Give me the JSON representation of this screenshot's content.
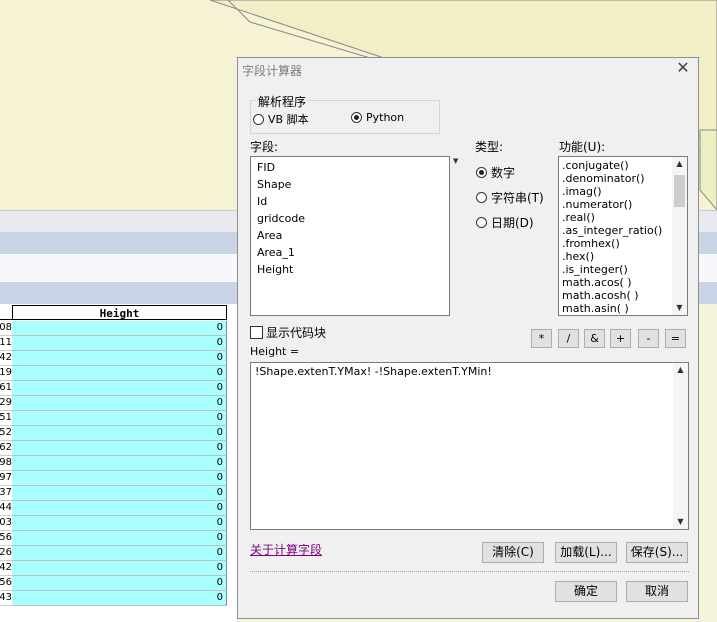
{
  "dialog": {
    "title": "字段计算器",
    "parser": {
      "label": "解析程序",
      "options": [
        {
          "label": "VB 脚本",
          "selected": false
        },
        {
          "label": "Python",
          "selected": true
        }
      ]
    },
    "fields_label": "字段:",
    "fields": [
      "FID",
      "Shape",
      "Id",
      "gridcode",
      "Area",
      "Area_1",
      "Height"
    ],
    "type_label": "类型:",
    "types": [
      {
        "label": "数字",
        "selected": true
      },
      {
        "label": "字符串(T)",
        "selected": false
      },
      {
        "label": "日期(D)",
        "selected": false
      }
    ],
    "functions_label": "功能(U):",
    "functions": [
      ".conjugate()",
      ".denominator()",
      ".imag()",
      ".numerator()",
      ".real()",
      ".as_integer_ratio()",
      ".fromhex()",
      ".hex()",
      ".is_integer()",
      "math.acos( )",
      "math.acosh( )",
      "math.asin( )"
    ],
    "show_codeblock_label": "显示代码块",
    "operators": [
      "*",
      "/",
      "&",
      "+",
      "-",
      "="
    ],
    "expression_label": "Height =",
    "expression": "!Shape.extenT.YMax! -!Shape.extenT.YMin!",
    "help_link": "关于计算字段",
    "buttons": {
      "clear": "清除(C)",
      "load": "加载(L)...",
      "save": "保存(S)...",
      "ok": "确定",
      "cancel": "取消"
    }
  },
  "table": {
    "header": "Height",
    "row_ids": [
      "08",
      "11",
      "42",
      "19",
      "61",
      "29",
      "51",
      "52",
      "62",
      "98",
      "97",
      "37",
      "44",
      "03",
      "56",
      "26",
      "42",
      "56",
      "43"
    ],
    "values": [
      "0",
      "0",
      "0",
      "0",
      "0",
      "0",
      "0",
      "0",
      "0",
      "0",
      "0",
      "0",
      "0",
      "0",
      "0",
      "0",
      "0",
      "0",
      "0"
    ]
  }
}
